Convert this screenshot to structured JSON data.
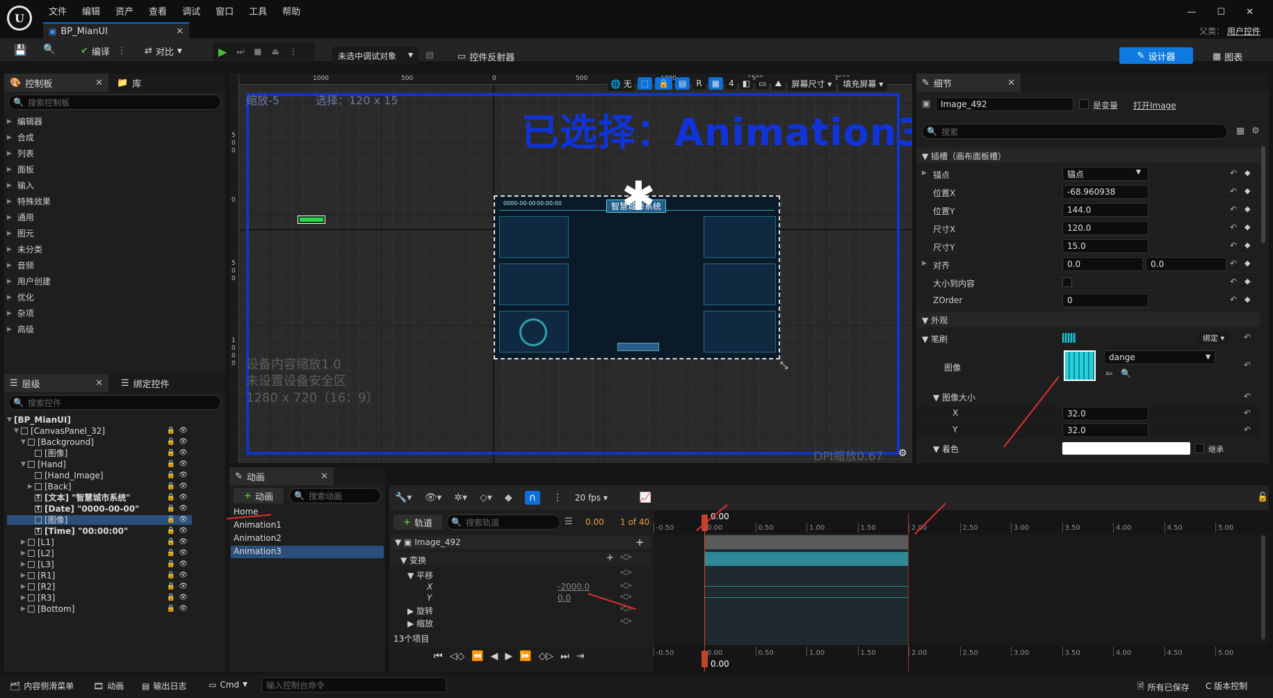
{
  "menu": [
    "文件",
    "编辑",
    "资产",
    "查看",
    "调试",
    "窗口",
    "工具",
    "帮助"
  ],
  "doc_tab": "BP_MianUI",
  "parent_label": "父类：",
  "parent_value": "用户控件",
  "window_controls": {
    "minimize": "—",
    "maximize": "☐",
    "close": "✕"
  },
  "toolbar": {
    "compile": "编译",
    "diff": "对比",
    "debug_target": "未选中调试对象",
    "widget_reflector": "控件反射器",
    "designer": "设计器",
    "graph": "图表"
  },
  "palette": {
    "tab": "控制板",
    "tab2": "库",
    "search_placeholder": "搜索控制板",
    "categories": [
      "编辑器",
      "合成",
      "列表",
      "面板",
      "输入",
      "特殊效果",
      "通用",
      "图元",
      "未分类",
      "音频",
      "用户创建",
      "优化",
      "杂项",
      "高级"
    ]
  },
  "hierarchy": {
    "tab": "层级",
    "tab2": "绑定控件",
    "search_placeholder": "搜索控件",
    "items": [
      {
        "label": "[BP_MianUI]",
        "bold": true
      },
      {
        "label": "[CanvasPanel_32]"
      },
      {
        "label": "[Background]"
      },
      {
        "label": "[图像]"
      },
      {
        "label": "[Hand]"
      },
      {
        "label": "[Hand_Image]"
      },
      {
        "label": "[Back]"
      },
      {
        "label": "[文本] \"智慧城市系统\"",
        "bold": true
      },
      {
        "label": "[Date] \"0000-00-00\"",
        "bold": true
      },
      {
        "label": "[图像]",
        "selected": true
      },
      {
        "label": "[Time] \"00:00:00\"",
        "bold": true
      },
      {
        "label": "[L1]"
      },
      {
        "label": "[L2]"
      },
      {
        "label": "[L3]"
      },
      {
        "label": "[R1]"
      },
      {
        "label": "[R2]"
      },
      {
        "label": "[R3]"
      },
      {
        "label": "[Bottom]"
      }
    ]
  },
  "viewport": {
    "zoom": "缩放-5",
    "selection": "选择：120 x 15",
    "selected_title": "已选择：Animation3",
    "none_label": "无",
    "r_label": "R",
    "grid_value": "4",
    "screen_size": "屏幕尺寸",
    "fill_screen": "填充屏幕",
    "device_scale": "设备内容缩放1.0",
    "safe_zone": "未设置设备安全区",
    "resolution": "1280 x 720（16：9）",
    "dpi": "DPI缩放0.67",
    "ruler_top": [
      "1000",
      "500",
      "0",
      "500",
      "1000",
      "1500",
      "2000"
    ],
    "ruler_left": [
      "5",
      "0",
      "0",
      "0",
      "5",
      "0",
      "0",
      "1",
      "0",
      "0",
      "0"
    ],
    "hud_title": "智慧城市系统",
    "hud_date": "0000-00-00",
    "hud_time": "00:00:00"
  },
  "details": {
    "tab": "细节",
    "name": "Image_492",
    "is_variable": "是变量",
    "open": "打开Image",
    "search_placeholder": "搜索",
    "slot_section": "插槽（画布面板槽）",
    "anchor_label": "锚点",
    "anchor_value": "锚点",
    "pos_x_label": "位置X",
    "pos_x": "-68.960938",
    "pos_y_label": "位置Y",
    "pos_y": "144.0",
    "size_x_label": "尺寸X",
    "size_x": "120.0",
    "size_y_label": "尺寸Y",
    "size_y": "15.0",
    "align_label": "对齐",
    "align_x": "0.0",
    "align_y": "0.0",
    "size_to_content": "大小到内容",
    "zorder_label": "ZOrder",
    "zorder": "0",
    "appearance": "外观",
    "brush": "笔刷",
    "bind": "绑定",
    "image_label": "图像",
    "image_asset": "dange",
    "image_size": "图像大小",
    "img_x_label": "X",
    "img_x": "32.0",
    "img_y_label": "Y",
    "img_y": "32.0",
    "tint": "着色",
    "inherit": "继承"
  },
  "animations": {
    "tab": "动画",
    "add": "动画",
    "search_placeholder": "搜索动画",
    "list": [
      "Home",
      "Animation1",
      "Animation2",
      "Animation3"
    ],
    "selected": "Animation3"
  },
  "sequencer": {
    "fps": "20 fps",
    "add_track": "轨道",
    "search_placeholder": "搜索轨道",
    "time": "0.00",
    "frame": "1 of 40",
    "track_name": "Image_492",
    "transform": "变换",
    "translation": "平移",
    "x_label": "X",
    "x_value": "-2000.0",
    "y_label": "Y",
    "y_value": "0.0",
    "rotation": "旋转",
    "scale": "缩放",
    "item_count": "13个项目",
    "playhead": "0.00",
    "ticks": [
      "-0.50",
      "0.00",
      "0.50",
      "1.00",
      "1.50",
      "2.00",
      "2.50",
      "3.00",
      "3.50",
      "4.00",
      "4.50",
      "5.00"
    ]
  },
  "statusbar": {
    "content_drawer": "内容侧滑菜单",
    "animation": "动画",
    "output_log": "输出日志",
    "cmd": "Cmd",
    "console_placeholder": "输入控制台命令",
    "saved": "所有已保存",
    "source_control": "C 版本控制"
  },
  "colors": {
    "accent": "#0070e0",
    "selection": "#2a4f7a",
    "title_blue": "#1034d8",
    "teal": "#2ea3ad",
    "arrow_red": "#e0302a"
  }
}
